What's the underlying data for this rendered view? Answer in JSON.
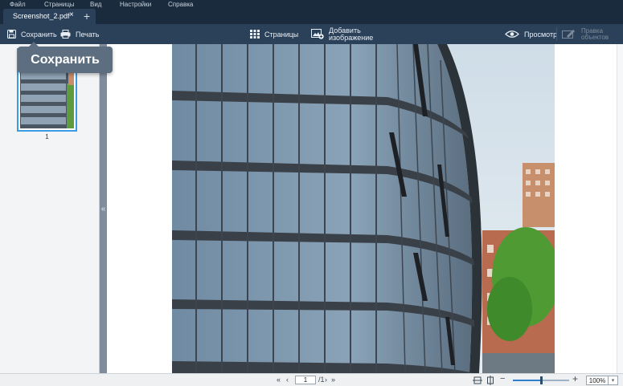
{
  "menu": {
    "items": [
      "Файл",
      "Страницы",
      "Вид",
      "Настройки",
      "Справка"
    ]
  },
  "tabs": {
    "active_title": "Screenshot_2.pdf",
    "close_glyph": "×",
    "new_tab_glyph": "+"
  },
  "toolbar": {
    "save_label": "Сохранить",
    "print_label": "Печать",
    "pages_label": "Страницы",
    "add_image_label_line1": "Добавить",
    "add_image_label_line2": "изображение",
    "preview_label": "Просмотр",
    "edit_objects_line1": "Правка",
    "edit_objects_line2": "объектов"
  },
  "tooltip": {
    "text": "Сохранить"
  },
  "sidebar": {
    "thumbnail_page_number": "1",
    "collapse_glyph": "«"
  },
  "statusbar": {
    "first_glyph": "«",
    "prev_glyph": "‹",
    "current_page": "1",
    "total_pages": "/1",
    "next_glyph": "›",
    "last_glyph": "»",
    "zoom_minus": "−",
    "zoom_plus": "+",
    "zoom_value": "100%",
    "zoom_fraction": 0.5,
    "zoom_dropdown_glyph": "▾"
  },
  "icons": {
    "save": "save-icon",
    "print": "printer-icon",
    "pages": "grid-icon",
    "add_image": "add-image-icon",
    "preview": "eye-icon",
    "edit_objects": "edit-objects-icon",
    "fit_width": "fit-width-icon",
    "fit_page": "fit-page-icon"
  },
  "colors": {
    "chrome_dark": "#1a2b3d",
    "toolbar": "#2b4159",
    "accent": "#3a9be5",
    "tooltip": "#5c6e80"
  }
}
